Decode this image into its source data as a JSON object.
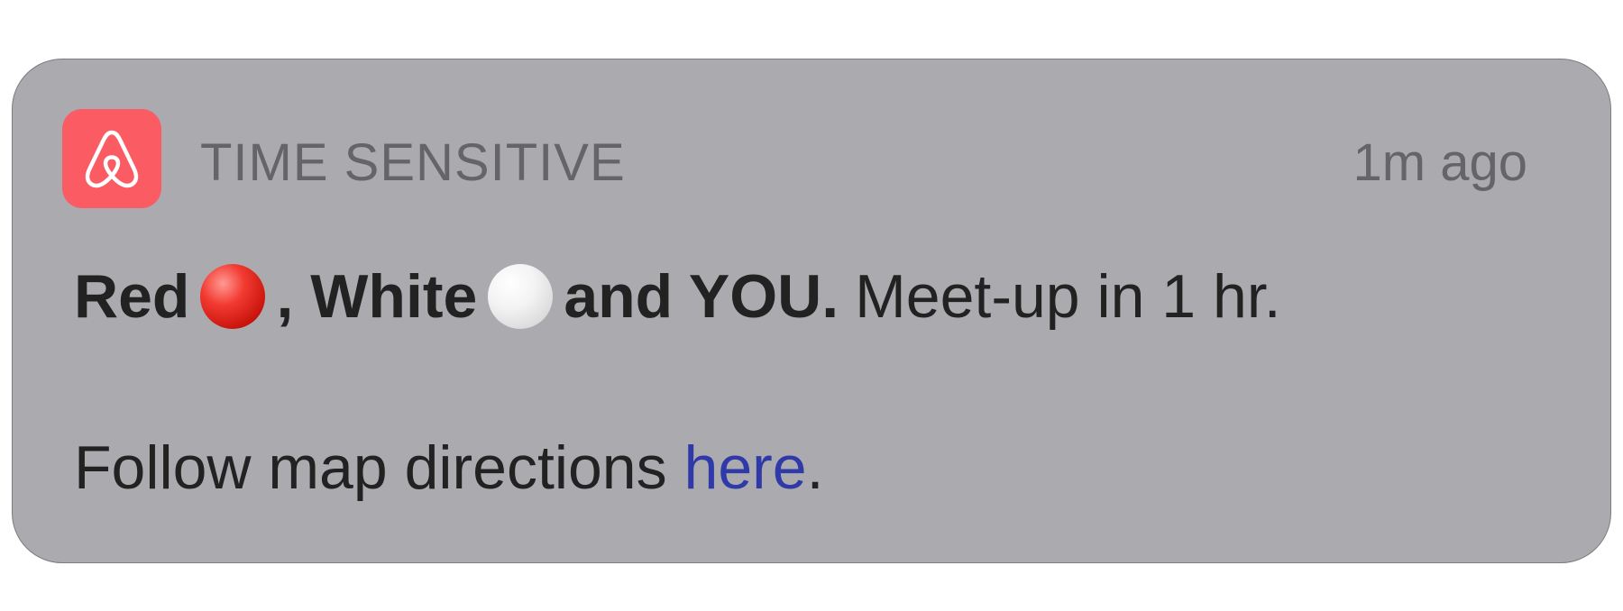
{
  "notification": {
    "header_label": "TIME SENSITIVE",
    "timestamp": "1m ago",
    "app_icon": "airbnb-logo-icon",
    "title_part1": "Red",
    "title_part2": ", White",
    "title_part3": "and YOU.",
    "title_rest": "Meet-up in 1 hr.",
    "follow_prefix": "Follow map directions",
    "link_text": "here",
    "follow_suffix": "."
  },
  "colors": {
    "card_background": "#abaaaf",
    "app_icon_background": "#fb5b63",
    "link": "#2f3aa8",
    "secondary_text": "#656469",
    "primary_text": "#222222"
  }
}
